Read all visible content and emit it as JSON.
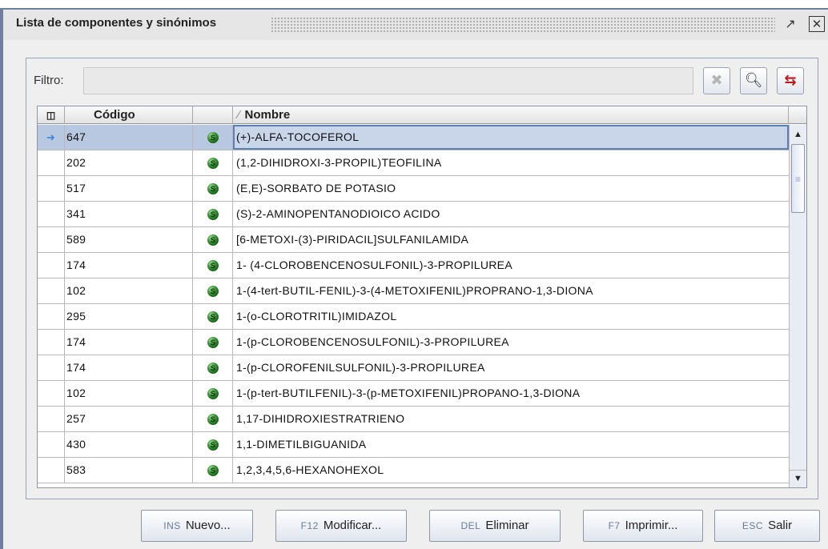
{
  "window": {
    "title": "Lista de componentes y sinónimos",
    "restore_icon": "restore-icon",
    "close_icon": "close-icon"
  },
  "filter": {
    "label": "Filtro:",
    "value": "",
    "clear_icon": "clear-icon",
    "search_icon": "search-icon",
    "swap_icon": "swap-arrows-icon"
  },
  "table": {
    "columns": {
      "codigo": "Código",
      "nombre": "Nombre"
    },
    "rows": [
      {
        "codigo": "647",
        "nombre": "(+)-ALFA-TOCOFEROL",
        "selected": true
      },
      {
        "codigo": "202",
        "nombre": "(1,2-DIHIDROXI-3-PROPIL)TEOFILINA"
      },
      {
        "codigo": "517",
        "nombre": "(E,E)-SORBATO DE POTASIO"
      },
      {
        "codigo": "341",
        "nombre": "(S)-2-AMINOPENTANODIOICO ACIDO"
      },
      {
        "codigo": "589",
        "nombre": "[6-METOXI-(3)-PIRIDACIL]SULFANILAMIDA"
      },
      {
        "codigo": "174",
        "nombre": "1- (4-CLOROBENCENOSULFONIL)-3-PROPILUREA"
      },
      {
        "codigo": "102",
        "nombre": "1-(4-tert-BUTIL-FENIL)-3-(4-METOXIFENIL)PROPRANO-1,3-DIONA"
      },
      {
        "codigo": "295",
        "nombre": "1-(o-CLOROTRITIL)IMIDAZOL"
      },
      {
        "codigo": "174",
        "nombre": "1-(p-CLOROBENCENOSULFONIL)-3-PROPILUREA"
      },
      {
        "codigo": "174",
        "nombre": "1-(p-CLOROFENILSULFONIL)-3-PROPILUREA"
      },
      {
        "codigo": "102",
        "nombre": "1-(p-tert-BUTILFENIL)-3-(p-METOXIFENIL)PROPANO-1,3-DIONA"
      },
      {
        "codigo": "257",
        "nombre": "1,17-DIHIDROXIESTRATRIENO"
      },
      {
        "codigo": "430",
        "nombre": "1,1-DIMETILBIGUANIDA"
      },
      {
        "codigo": "583",
        "nombre": "1,2,3,4,5,6-HEXANOHEXOL"
      }
    ],
    "row_icon": "synonym-green-s-icon",
    "row_icon_letter": "S",
    "selected_row_icon": "arrow-right-icon"
  },
  "buttons": [
    {
      "key": "INS",
      "label": "Nuevo..."
    },
    {
      "key": "F12",
      "label": "Modificar..."
    },
    {
      "key": "DEL",
      "label": "Eliminar"
    },
    {
      "key": "F7",
      "label": "Imprimir..."
    },
    {
      "key": "ESC",
      "label": "Salir"
    }
  ],
  "colors": {
    "selection": "#b8c8e0",
    "selection_border": "#5b7fb6",
    "icon_green": "#2e8b2e",
    "swap_red": "#c0141a"
  }
}
